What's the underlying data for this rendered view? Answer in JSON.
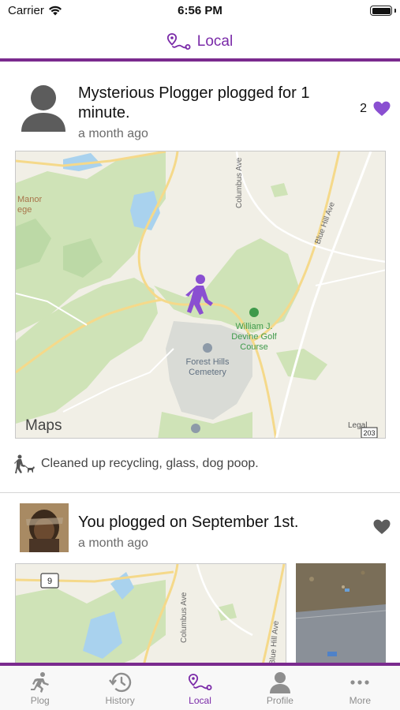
{
  "status_bar": {
    "carrier": "Carrier",
    "time": "6:56 PM"
  },
  "nav": {
    "title": "Local"
  },
  "colors": {
    "accent": "#7a2aa8",
    "rule": "#7a2a8e",
    "tab_inactive": "#8e8e8e"
  },
  "posts": [
    {
      "author": "Mysterious Plogger",
      "action": " plogged for 1 minute.",
      "time_ago": "a month ago",
      "like_count": "2",
      "liked": true,
      "map": {
        "labels": {
          "manor": "Manor",
          "ege": "ege",
          "columbus": "Columbus Ave",
          "blue_hill": "Blue Hill Ave",
          "golf_1": "William J.",
          "golf_2": "Devine Golf",
          "golf_3": "Course",
          "cemetery_1": "Forest Hills",
          "cemetery_2": "Cemetery",
          "brand": "Maps",
          "legal": "Legal",
          "route": "203"
        }
      },
      "caption": "Cleaned up recycling, glass, dog poop."
    },
    {
      "author_prefix": "You plogged on September 1st.",
      "time_ago": "a month ago",
      "liked": false,
      "map": {
        "labels": {
          "route": "9",
          "columbus": "Columbus Ave",
          "blue_hill": "Blue Hill Ave"
        }
      }
    }
  ],
  "tabs": [
    {
      "label": "Plog",
      "icon": "runner-icon"
    },
    {
      "label": "History",
      "icon": "history-icon"
    },
    {
      "label": "Local",
      "icon": "route-icon"
    },
    {
      "label": "Profile",
      "icon": "person-icon"
    },
    {
      "label": "More",
      "icon": "ellipsis-icon"
    }
  ]
}
